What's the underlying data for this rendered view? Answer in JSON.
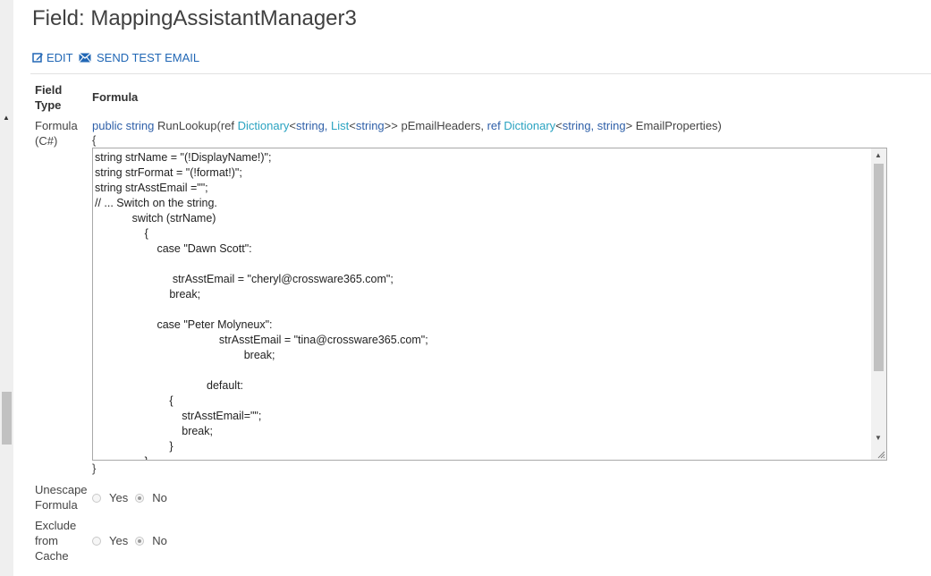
{
  "page": {
    "title": "Field: MappingAssistantManager3"
  },
  "toolbar": {
    "edit_label": "EDIT",
    "send_test_email_label": "SEND TEST EMAIL"
  },
  "table": {
    "col_field_type": "Field Type",
    "col_formula": "Formula"
  },
  "formula_row": {
    "label": "Formula (C#)",
    "signature": {
      "public_string": "public string",
      "method": "RunLookup(",
      "ref1": "ref",
      "dictionary1": "Dictionary",
      "lt1": "<",
      "string1": "string,",
      "list": "List",
      "lt2": "<",
      "string2": "string",
      "gt_gt": ">> pEmailHeaders,",
      "ref2": "ref",
      "dictionary2": "Dictionary",
      "lt3": "<",
      "string3": "string,",
      "string4": "string",
      "gt_end": "> EmailProperties)"
    },
    "open_brace": "{",
    "close_brace": "}",
    "code": "string strName = \"(!DisplayName!)\";\nstring strFormat = \"(!format!)\";\nstring strAsstEmail =\"\";\n// ... Switch on the string.\n            switch (strName)\n                {\n                    case \"Dawn Scott\":\n\n                         strAsstEmail = \"cheryl@crossware365.com\";\n                        break;\n\n                    case \"Peter Molyneux\":\n                                        strAsstEmail = \"tina@crossware365.com\";\n                                                break;\n\n                                    default:\n                        {\n                            strAsstEmail=\"\";\n                            break;\n                        }\n                }"
  },
  "unescape_row": {
    "label": "Unescape Formula",
    "yes": "Yes",
    "no": "No",
    "selected": "No"
  },
  "exclude_row": {
    "label": "Exclude from Cache",
    "yes": "Yes",
    "no": "No",
    "selected": "No"
  },
  "colors": {
    "link": "#2167b5",
    "keyword": "#2e5fa8",
    "type": "#2aa3c1"
  },
  "icons": {
    "edit": "edit-icon",
    "email": "envelope-icon"
  }
}
